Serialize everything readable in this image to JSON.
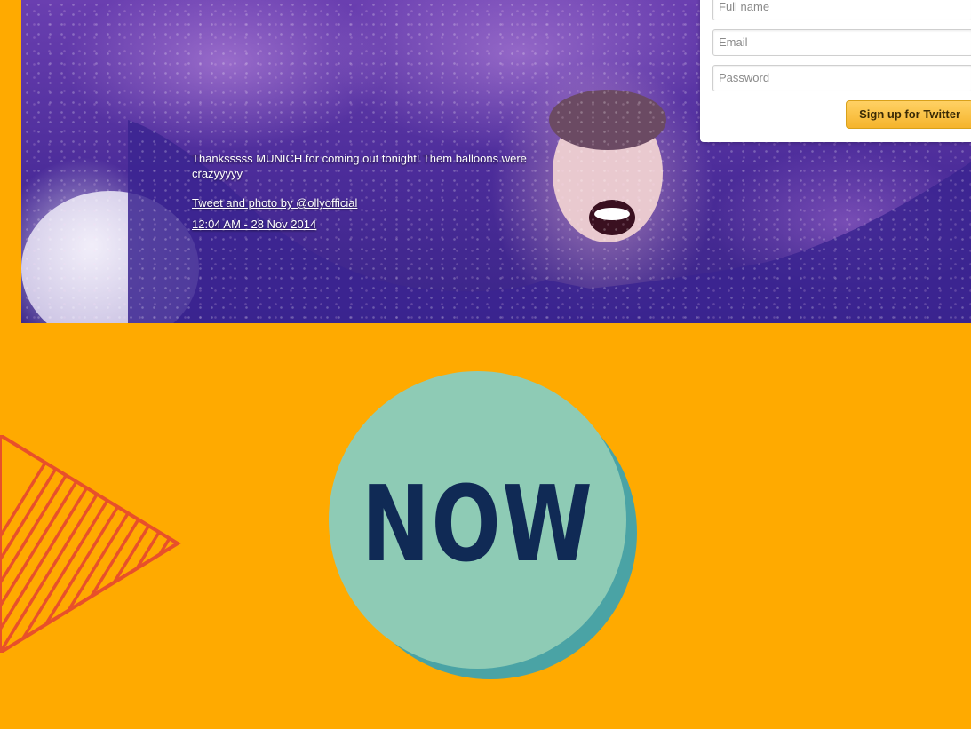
{
  "tweet": {
    "text": "Thanksssss MUNICH for coming out tonight! Them balloons were crazyyyyy",
    "byline": "Tweet and photo by @ollyofficial",
    "timestamp": "12:04 AM - 28 Nov 2014"
  },
  "signup_form": {
    "full_name_placeholder": "Full name",
    "email_placeholder": "Email",
    "password_placeholder": "Password",
    "submit_label": "Sign up for Twitter"
  },
  "badge": {
    "label": "NOW"
  },
  "colors": {
    "background": "#FFAA00",
    "badge_fill": "#8ecbb5",
    "badge_shadow": "#4aa3a5",
    "badge_text": "#102a55",
    "triangle_stripes": "#E8502A",
    "button": "#f5b42c"
  },
  "icons": [
    "striped-triangle-decoration"
  ]
}
